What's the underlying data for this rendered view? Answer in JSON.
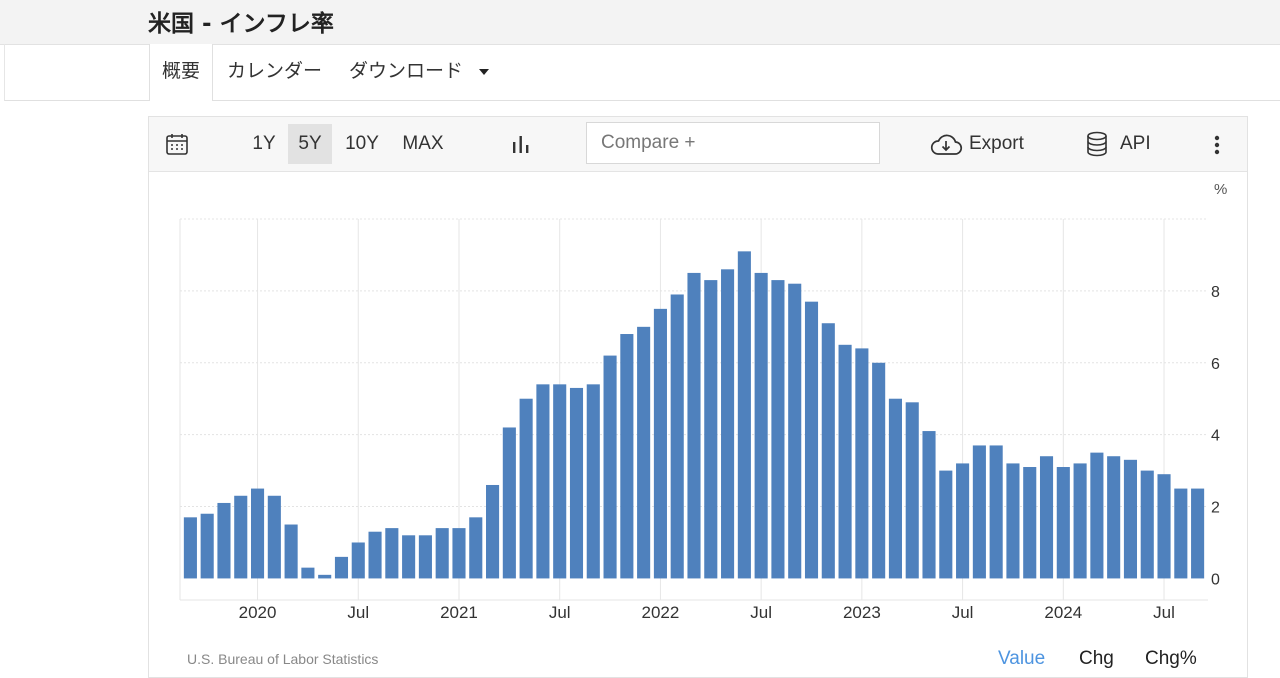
{
  "page": {
    "title": "米国 - インフレ率"
  },
  "tabs": [
    {
      "label": "概要",
      "active": true
    },
    {
      "label": "カレンダー",
      "active": false
    },
    {
      "label": "ダウンロード",
      "active": false,
      "dropdown": true
    }
  ],
  "toolbar": {
    "ranges": [
      "1Y",
      "5Y",
      "10Y",
      "MAX"
    ],
    "selected_range": "5Y",
    "compare_placeholder": "Compare +",
    "export_label": "Export",
    "api_label": "API",
    "icons": [
      "calendar-icon",
      "bar-chart-icon",
      "cloud-download-icon",
      "database-icon",
      "more-vertical-icon"
    ]
  },
  "chart_data": {
    "type": "bar",
    "title": "",
    "xlabel": "",
    "ylabel": "%",
    "ylim": [
      -0.6,
      10
    ],
    "yticks": [
      0,
      2,
      4,
      6,
      8
    ],
    "grid": true,
    "bar_color": "#4f81bd",
    "x_ticks": [
      {
        "label": "2020",
        "index": 4.5
      },
      {
        "label": "Jul",
        "index": 10.5
      },
      {
        "label": "2021",
        "index": 16.5
      },
      {
        "label": "Jul",
        "index": 22.5
      },
      {
        "label": "2022",
        "index": 28.5
      },
      {
        "label": "Jul",
        "index": 34.5
      },
      {
        "label": "2023",
        "index": 40.5
      },
      {
        "label": "Jul",
        "index": 46.5
      },
      {
        "label": "2024",
        "index": 52.5
      },
      {
        "label": "Jul",
        "index": 58.5
      }
    ],
    "categories": [
      "2019-08",
      "2019-09",
      "2019-10",
      "2019-11",
      "2019-12",
      "2020-01",
      "2020-02",
      "2020-03",
      "2020-04",
      "2020-05",
      "2020-06",
      "2020-07",
      "2020-08",
      "2020-09",
      "2020-10",
      "2020-11",
      "2020-12",
      "2021-01",
      "2021-02",
      "2021-03",
      "2021-04",
      "2021-05",
      "2021-06",
      "2021-07",
      "2021-08",
      "2021-09",
      "2021-10",
      "2021-11",
      "2021-12",
      "2022-01",
      "2022-02",
      "2022-03",
      "2022-04",
      "2022-05",
      "2022-06",
      "2022-07",
      "2022-08",
      "2022-09",
      "2022-10",
      "2022-11",
      "2022-12",
      "2023-01",
      "2023-02",
      "2023-03",
      "2023-04",
      "2023-05",
      "2023-06",
      "2023-07",
      "2023-08",
      "2023-09",
      "2023-10",
      "2023-11",
      "2023-12",
      "2024-01",
      "2024-02",
      "2024-03",
      "2024-04",
      "2024-05",
      "2024-06",
      "2024-07",
      "2024-08"
    ],
    "values": [
      1.7,
      1.8,
      2.1,
      2.3,
      2.5,
      2.3,
      1.5,
      0.3,
      0.1,
      0.6,
      1.0,
      1.3,
      1.4,
      1.2,
      1.2,
      1.4,
      1.4,
      1.7,
      2.6,
      4.2,
      5.0,
      5.4,
      5.4,
      5.3,
      5.4,
      6.2,
      6.8,
      7.0,
      7.5,
      7.9,
      8.5,
      8.3,
      8.6,
      9.1,
      8.5,
      8.3,
      8.2,
      7.7,
      7.1,
      6.5,
      6.4,
      6.0,
      5.0,
      4.9,
      4.1,
      3.0,
      3.2,
      3.7,
      3.7,
      3.2,
      3.1,
      3.4,
      3.1,
      3.2,
      3.5,
      3.4,
      3.3,
      3.0,
      2.9,
      2.5,
      2.5
    ]
  },
  "footer": {
    "source": "U.S. Bureau of Labor Statistics",
    "modes": [
      "Value",
      "Chg",
      "Chg%"
    ],
    "active_mode": "Value"
  },
  "colors": {
    "bar": "#4f81bd",
    "accent": "#4d94e0",
    "grid": "#e6e6e6"
  }
}
